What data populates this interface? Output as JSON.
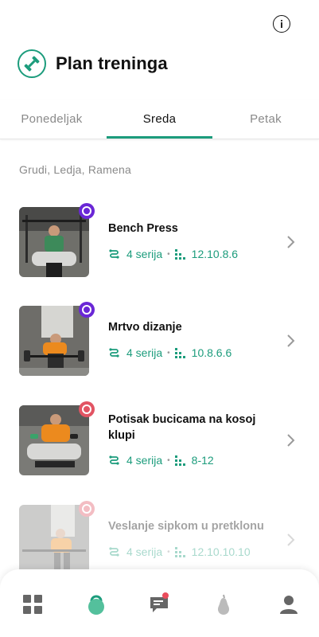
{
  "colors": {
    "accent": "#1c9c7c",
    "purple": "#6a27d6",
    "red": "#e25463",
    "pink": "#f3a9b2",
    "muted": "#8a8a8a",
    "notification": "#ea4c5c"
  },
  "header": {
    "title": "Plan treninga",
    "logo_icon": "dumbbell-icon",
    "info_icon": "info-icon"
  },
  "tabs": [
    {
      "label": "Ponedeljak",
      "active": false
    },
    {
      "label": "Sreda",
      "active": true
    },
    {
      "label": "Petak",
      "active": false
    }
  ],
  "muscle_groups": "Grudi, Ledja, Ramena",
  "exercises": [
    {
      "name": "Bench Press",
      "sets": "4 serija",
      "reps": "12.10.8.6",
      "badge_color": "purple"
    },
    {
      "name": "Mrtvo dizanje",
      "sets": "4 serija",
      "reps": "10.8.6.6",
      "badge_color": "purple"
    },
    {
      "name": "Potisak bucicama na kosoj klupi",
      "sets": "4 serija",
      "reps": "8-12",
      "badge_color": "red"
    },
    {
      "name": "Veslanje sipkom u pretklonu",
      "sets": "4 serija",
      "reps": "12.10.10.10",
      "badge_color": "pink"
    }
  ],
  "bottom_nav": [
    {
      "name": "dashboard-icon",
      "active": false
    },
    {
      "name": "kettlebell-icon",
      "active": true
    },
    {
      "name": "chat-icon",
      "active": false,
      "notification": true
    },
    {
      "name": "pear-icon",
      "active": false
    },
    {
      "name": "profile-icon",
      "active": false
    }
  ]
}
